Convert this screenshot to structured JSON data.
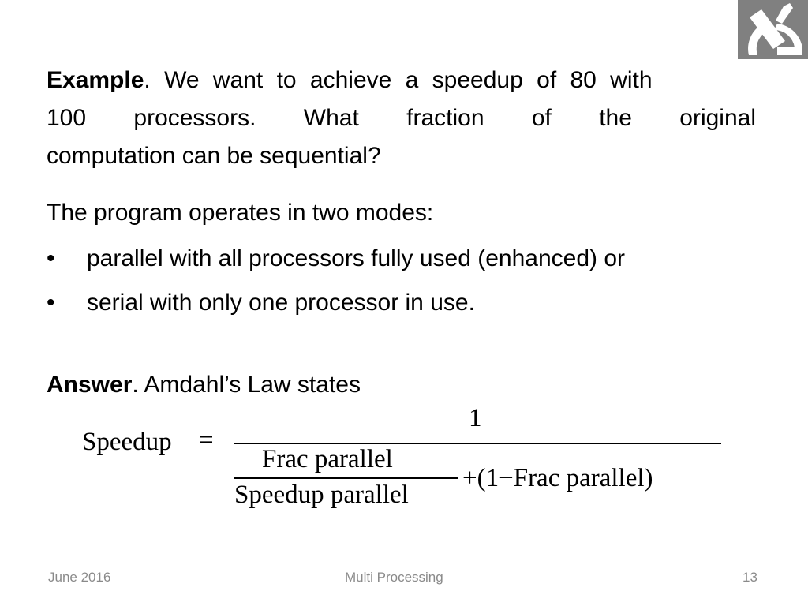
{
  "logo": {
    "icon": "institution-logo-icon",
    "bg": "#808080"
  },
  "example": {
    "label": "Example",
    "line1_rest": ".   We want to achieve a speedup of 80 with",
    "line2_words": [
      "100",
      "processors.",
      "What",
      "fraction",
      "of",
      "the",
      "original"
    ],
    "line3": "computation can be sequential?"
  },
  "modes": {
    "intro": "The program operates in two modes:",
    "bullets": [
      "parallel with all processors fully used (enhanced) or",
      "serial with only one processor in use."
    ],
    "bullet_char": "•"
  },
  "answer": {
    "label": "Answer",
    "rest": ". Amdahl’s Law states"
  },
  "formula": {
    "lhs": "Speedup",
    "equals": "=",
    "numerator": "1",
    "inner_numerator": "Frac parallel",
    "inner_denominator": "Speedup parallel",
    "tail": "+(1−Frac parallel)"
  },
  "footer": {
    "date": "June 2016",
    "title": "Multi Processing",
    "page": "13"
  }
}
